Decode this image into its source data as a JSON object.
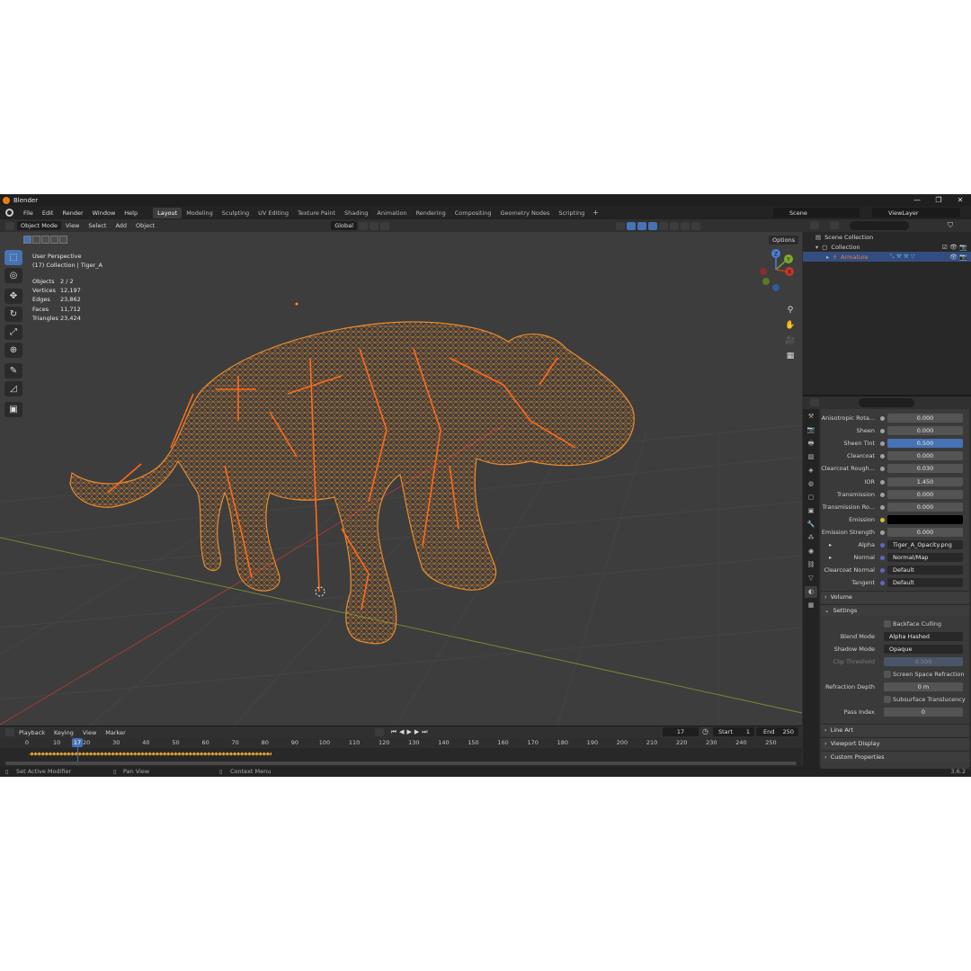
{
  "app": {
    "title": "Blender",
    "version": "3.6.2"
  },
  "window_controls": [
    "—",
    "❐",
    "✕"
  ],
  "menu": [
    "File",
    "Edit",
    "Render",
    "Window",
    "Help"
  ],
  "workspaces": [
    "Layout",
    "Modeling",
    "Sculpting",
    "UV Editing",
    "Texture Paint",
    "Shading",
    "Animation",
    "Rendering",
    "Compositing",
    "Geometry Nodes",
    "Scripting"
  ],
  "active_workspace": "Layout",
  "scene": "Scene",
  "view_layer": "ViewLayer",
  "viewport_header": {
    "mode": "Object Mode",
    "menus": [
      "View",
      "Select",
      "Add",
      "Object"
    ],
    "orientation": "Global",
    "options": "Options"
  },
  "viewport": {
    "perspective": "User Perspective",
    "collection_line": "(17) Collection | Tiger_A",
    "stats": [
      {
        "k": "Objects",
        "v": "2 / 2"
      },
      {
        "k": "Vertices",
        "v": "12,197"
      },
      {
        "k": "Edges",
        "v": "23,862"
      },
      {
        "k": "Faces",
        "v": "11,712"
      },
      {
        "k": "Triangles",
        "v": "23,424"
      }
    ],
    "gizmo_labels": {
      "z": "Z",
      "y": "Y",
      "x": "X"
    }
  },
  "timeline": {
    "menus": [
      "Playback",
      "Keying",
      "View",
      "Marker"
    ],
    "current_frame": "17",
    "start_label": "Start",
    "start": "1",
    "end_label": "End",
    "end": "250",
    "ruler": [
      "0",
      "10",
      "20",
      "30",
      "40",
      "50",
      "60",
      "70",
      "80",
      "90",
      "100",
      "110",
      "120",
      "130",
      "140",
      "150",
      "160",
      "170",
      "180",
      "190",
      "200",
      "210",
      "220",
      "230",
      "240",
      "250"
    ]
  },
  "status": {
    "left": "Set Active Modifier",
    "mid": "Pan View",
    "right": "Context Menu"
  },
  "outliner": {
    "root": "Scene Collection",
    "collection": "Collection",
    "object": "Armature"
  },
  "properties": {
    "rows": [
      {
        "label": "Anisotropic Rota...",
        "value": "0.000",
        "style": ""
      },
      {
        "label": "Sheen",
        "value": "0.000",
        "style": ""
      },
      {
        "label": "Sheen Tint",
        "value": "0.500",
        "style": "blue"
      },
      {
        "label": "Clearcoat",
        "value": "0.000",
        "style": ""
      },
      {
        "label": "Clearcoat Rough...",
        "value": "0.030",
        "style": ""
      },
      {
        "label": "IOR",
        "value": "1.450",
        "style": ""
      },
      {
        "label": "Transmission",
        "value": "0.000",
        "style": ""
      },
      {
        "label": "Transmission Ro...",
        "value": "0.000",
        "style": ""
      },
      {
        "label": "Emission",
        "value": "",
        "style": "black"
      },
      {
        "label": "Emission Strength",
        "value": "0.000",
        "style": ""
      },
      {
        "label": "Alpha",
        "value": "Tiger_A_Opacity.png",
        "style": "dark"
      },
      {
        "label": "Normal",
        "value": "Normal/Map",
        "style": "dark"
      },
      {
        "label": "Clearcoat Normal",
        "value": "Default",
        "style": "dark"
      },
      {
        "label": "Tangent",
        "value": "Default",
        "style": "dark"
      }
    ],
    "panel_volume": "Volume",
    "panel_settings": "Settings",
    "backface": "Backface Culling",
    "blend_mode_label": "Blend Mode",
    "blend_mode": "Alpha Hashed",
    "shadow_mode_label": "Shadow Mode",
    "shadow_mode": "Opaque",
    "clip_label": "Clip Threshold",
    "clip_value": "0.500",
    "ssr": "Screen Space Refraction",
    "refraction_label": "Refraction Depth",
    "refraction_value": "0 m",
    "subsurface": "Subsurface Translucency",
    "pass_label": "Pass Index",
    "pass_value": "0",
    "panel_lineart": "Line Art",
    "panel_viewport": "Viewport Display",
    "panel_custom": "Custom Properties"
  },
  "colors": {
    "accent": "#4772b3",
    "wire": "#e88a2e",
    "bone": "#ff6a1a",
    "selected_text": "#e8813a"
  }
}
